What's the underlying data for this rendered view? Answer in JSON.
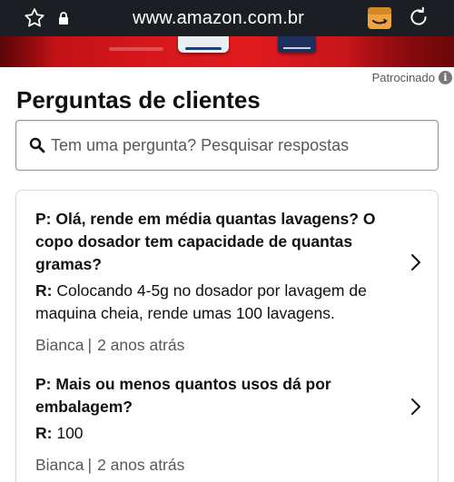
{
  "browser": {
    "url": "www.amazon.com.br"
  },
  "sponsored": {
    "label": "Patrocinado",
    "info_glyph": "i"
  },
  "questions": {
    "title": "Perguntas de clientes",
    "search_placeholder": "Tem uma pergunta? Pesquisar respostas",
    "items": [
      {
        "q_prefix": "P:",
        "question": "Olá, rende em média quantas lavagens? O copo dosador tem capacidade de quantas gramas?",
        "a_prefix": "R:",
        "answer": "Colocando 4-5g no dosador por lavagem de maquina cheia, rende umas 100 lavagens.",
        "author": "Bianca",
        "separator": "|",
        "time": "2 anos atrás"
      },
      {
        "q_prefix": "P:",
        "question": "Mais ou menos quantos usos dá por embalagem?",
        "a_prefix": "R:",
        "answer": "100",
        "author": "Bianca",
        "separator": "|",
        "time": "2 anos atrás"
      }
    ]
  },
  "colors": {
    "browser_bar": "#1b1f24",
    "text": "#0f1111",
    "muted": "#565959",
    "banner_red": "#e11b1e"
  },
  "icons": [
    "star-icon",
    "lock-icon",
    "extension-icon",
    "reload-icon",
    "info-icon",
    "search-icon",
    "chevron-right-icon"
  ]
}
